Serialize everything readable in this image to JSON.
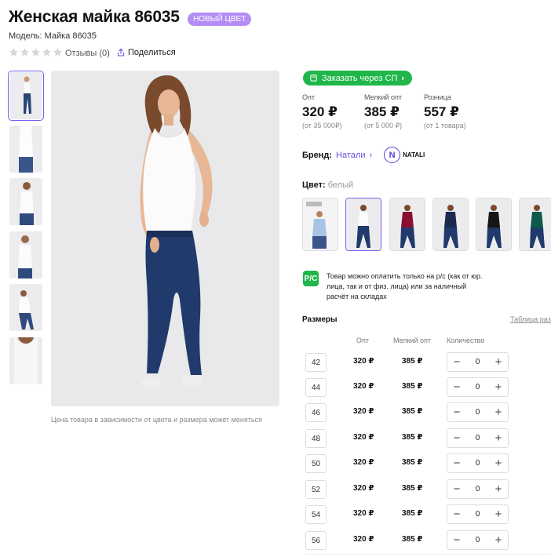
{
  "product": {
    "title": "Женская майка 86035",
    "badge": "НОВЫЙ ЦВЕТ",
    "model": "Модель: Майка 86035",
    "reviews": "Отзывы (0)",
    "share": "Поделиться",
    "rating_stars": 0
  },
  "gallery": {
    "caption": "Цена товара в зависимости от цвета и размера может меняться",
    "thumbnails": 6
  },
  "order_sp": {
    "label": "Заказать через СП"
  },
  "prices": [
    {
      "label": "Опт",
      "value": "320 ₽",
      "note": "(от 35 000₽)"
    },
    {
      "label": "Мелкий опт",
      "value": "385 ₽",
      "note": "(от 5 000 ₽)"
    },
    {
      "label": "Розница",
      "value": "557 ₽",
      "note": "(от 1 товара)"
    }
  ],
  "brand": {
    "label": "Бренд:",
    "name": "Натали",
    "logo_text": "NATALI"
  },
  "color": {
    "label": "Цвет:",
    "value": "белый"
  },
  "payment_note": "Товар можно оплатить только на р/с (как от юр. лица, так и от физ. лица) или за наличный расчёт на складах",
  "payment_icon": "Р/С",
  "sizes": {
    "heading": "Размеры",
    "table_link": "Таблица раз",
    "columns": [
      "Опт",
      "Мелкий опт",
      "Количество"
    ],
    "rows": [
      {
        "size": "42",
        "opt": "320 ₽",
        "small_opt": "385 ₽",
        "qty": "0"
      },
      {
        "size": "44",
        "opt": "320 ₽",
        "small_opt": "385 ₽",
        "qty": "0"
      },
      {
        "size": "46",
        "opt": "320 ₽",
        "small_opt": "385 ₽",
        "qty": "0"
      },
      {
        "size": "48",
        "opt": "320 ₽",
        "small_opt": "385 ₽",
        "qty": "0"
      },
      {
        "size": "50",
        "opt": "320 ₽",
        "small_opt": "385 ₽",
        "qty": "0"
      },
      {
        "size": "52",
        "opt": "320 ₽",
        "small_opt": "385 ₽",
        "qty": "0"
      },
      {
        "size": "54",
        "opt": "320 ₽",
        "small_opt": "385 ₽",
        "qty": "0"
      },
      {
        "size": "56",
        "opt": "320 ₽",
        "small_opt": "385 ₽",
        "qty": "0"
      }
    ],
    "minus": "−",
    "plus": "+"
  },
  "colors": {
    "accent": "#7b5cf0",
    "badge": "#b58cf6",
    "green": "#20b74a",
    "jeans": "#1f3a6b"
  }
}
